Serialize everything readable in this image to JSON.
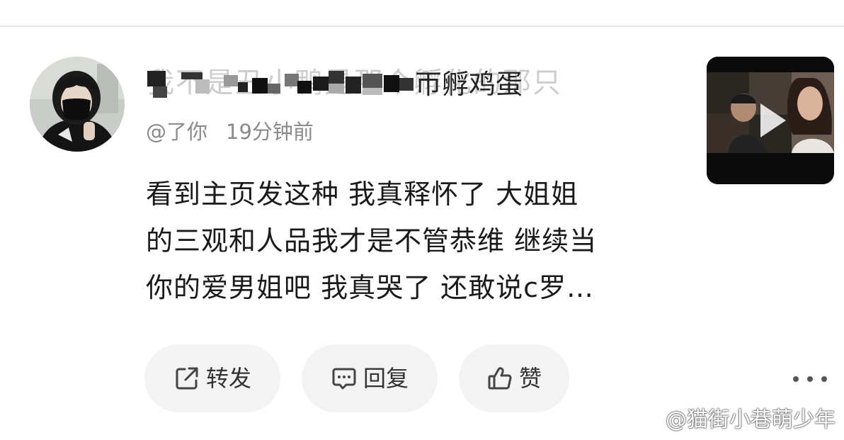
{
  "comment": {
    "username": "我不是丑小鸭是那个孵化的那只鸡蛋",
    "handle": "@了你",
    "time": "19分钟前",
    "content_lines": [
      "看到主页发这种 我真释怀了 大姐姐",
      "的三观和人品我才是不管恭维 继续当",
      "你的爱男姐吧 我真哭了 还敢说c罗…"
    ]
  },
  "actions": {
    "repost_label": "转发",
    "reply_label": "回复",
    "like_label": "赞"
  },
  "icons": {
    "repost": "share-out-icon",
    "reply": "comment-bubble-icon",
    "like": "thumbs-up-icon",
    "more": "more-dots-icon",
    "play": "play-icon",
    "watermark": "weibo-logo-icon"
  },
  "watermark": {
    "text": "@猫街小巷萌少年"
  },
  "colors": {
    "text_primary": "#1a1a1a",
    "text_secondary": "#8a8a8a",
    "button_bg": "#f3f3f3",
    "divider": "#e8e8e8"
  }
}
